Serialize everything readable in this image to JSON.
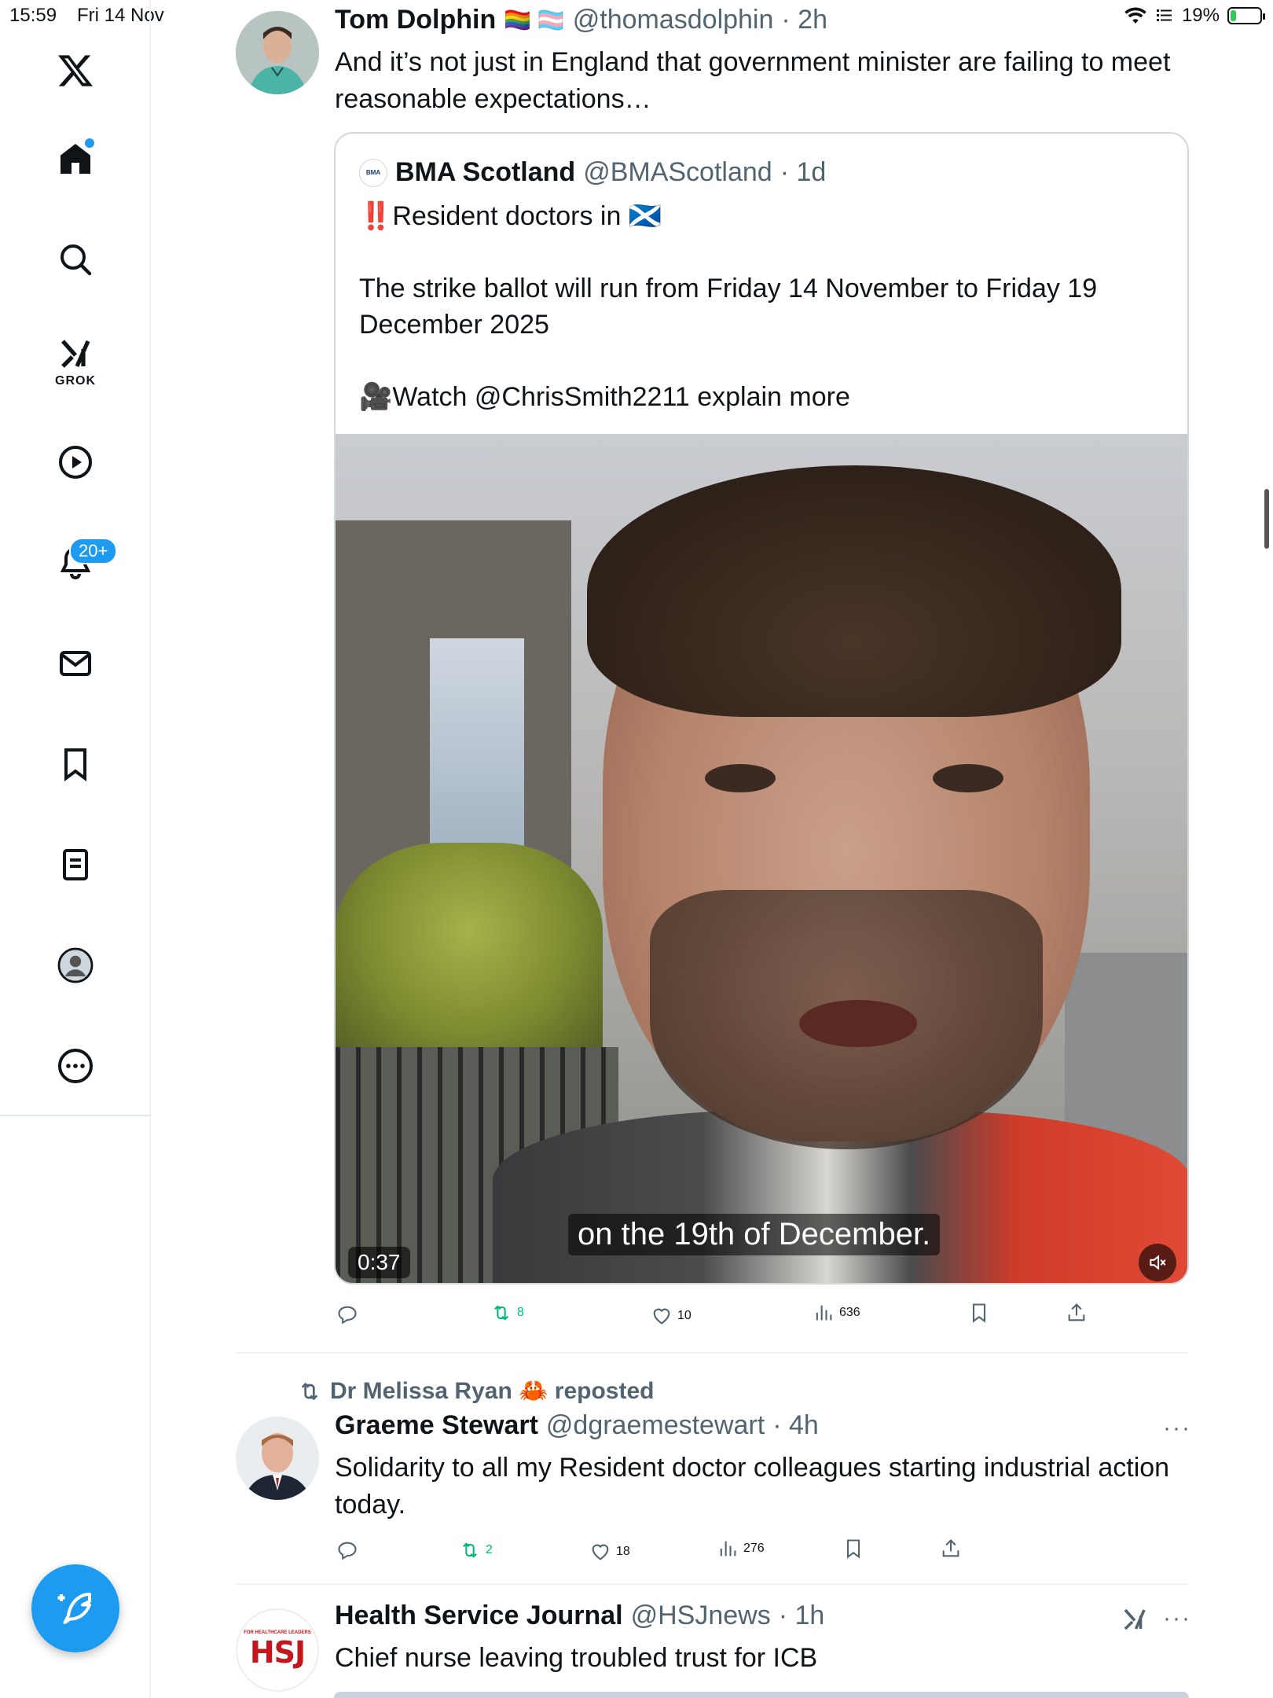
{
  "status_bar": {
    "time": "15:59",
    "date": "Fri 14 Nov",
    "battery": "19%",
    "battery_level": 0.19
  },
  "sidebar": {
    "items": [
      {
        "name": "x-logo-icon"
      },
      {
        "name": "home-icon"
      },
      {
        "name": "search-icon"
      },
      {
        "name": "grok-icon",
        "label": "GROK"
      },
      {
        "name": "video-icon"
      },
      {
        "name": "notifications-icon",
        "badge": "20+"
      },
      {
        "name": "messages-icon"
      },
      {
        "name": "bookmarks-icon"
      },
      {
        "name": "lists-icon"
      },
      {
        "name": "profile-icon"
      },
      {
        "name": "more-icon"
      }
    ],
    "accent": "#1d9bf0"
  },
  "tweet1": {
    "name": "Tom Dolphin",
    "name_emoji": "🏳️‍🌈 🏳️‍⚧️",
    "handle": "@thomasdolphin",
    "time": "· 2h",
    "text": "And it’s not just in England that government minister are failing to meet reasonable expectations…",
    "quote": {
      "name": "BMA Scotland",
      "handle": "@BMAScotland",
      "time": "· 1d",
      "avatar_text": "BMA",
      "line1": "‼️Resident doctors in 🏴󠁧󠁢󠁳󠁣󠁴󠁿",
      "line2": "The strike ballot will run from Friday 14 November to Friday 19 December 2025",
      "line3": "🎥Watch @ChrisSmith2211 explain more",
      "video_caption": "on the 19th of December.",
      "video_duration": "0:37"
    },
    "stats": {
      "replies": "",
      "reposts": "8",
      "likes": "10",
      "views": "636"
    }
  },
  "tweet2": {
    "reposted_by": "Dr Melissa Ryan 🦀 reposted",
    "name": "Graeme Stewart",
    "handle": "@dgraemestewart",
    "time": "· 4h",
    "text": "Solidarity to all my Resident doctor colleagues starting industrial action today.",
    "stats": {
      "replies": "",
      "reposts": "2",
      "likes": "18",
      "views": "276"
    }
  },
  "tweet3": {
    "name": "Health Service Journal",
    "handle": "@HSJnews",
    "time": "· 1h",
    "text": "Chief nurse leaving troubled trust for ICB",
    "avatar_small": "FOR HEALTHCARE LEADERS",
    "avatar_big": "HSJ"
  }
}
